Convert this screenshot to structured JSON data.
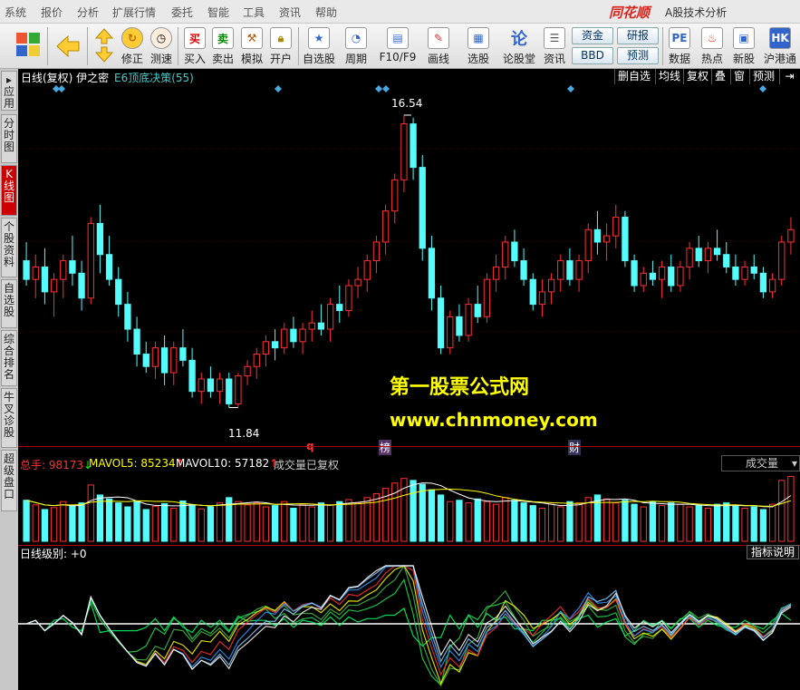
{
  "menubar": {
    "items": [
      "系统",
      "报价",
      "分析",
      "扩展行情",
      "委托",
      "智能",
      "工具",
      "资讯",
      "帮助"
    ],
    "logo": "同花顺",
    "title": "A股技术分析"
  },
  "toolbar": {
    "items": [
      "修正",
      "测速",
      "买入",
      "卖出",
      "模拟",
      "开户",
      "自选股",
      "周期",
      "F10/F9",
      "画线",
      "选股",
      "论股堂",
      "资讯",
      "数据",
      "热点",
      "新股",
      "沪港通"
    ],
    "buy_glyph": "买",
    "sell_glyph": "卖",
    "lun_glyph": "论",
    "small_buttons": [
      "资金",
      "研报",
      "BBD",
      "预测"
    ]
  },
  "sidebar": {
    "items": [
      "应用",
      "分时图",
      "K线图",
      "个股资料",
      "自选股",
      "综合排名",
      "牛叉诊股",
      "超级盘口"
    ]
  },
  "chart": {
    "header": "日线(复权)  伊之密",
    "indicator": "E6顶底决策(55)",
    "buttons": [
      "删自选",
      "均线",
      "复权",
      "叠",
      "窗",
      "预测"
    ],
    "high_label": "16.54",
    "low_label": "11.84",
    "markers": [
      "q",
      "榜",
      "财"
    ],
    "watermark1": "第一股票公式网",
    "watermark2": "www.chnmoney.com"
  },
  "volume": {
    "total_label": "总手: 98173",
    "total_arrow": "↓",
    "mavol5": "MAVOL5: 85234",
    "mavol5_arrow": "↑",
    "mavol10": "MAVOL10: 57182",
    "mavol10_arrow": "↑",
    "note": "成交量已复权",
    "dropdown": "成交量"
  },
  "indicator_panel": {
    "label": "日线级别: +0",
    "button": "指标说明"
  },
  "colors": {
    "up": "#ff3030",
    "down": "#54fcfc",
    "bg": "#000000",
    "grid": "#aa0000",
    "watermark": "#ffff00"
  },
  "chart_data": {
    "type": "candlestick",
    "price_range": [
      11.84,
      16.54
    ],
    "note": "daily OHLC candles, up=red outline, down=cyan filled",
    "series": [
      {
        "o": 14.2,
        "h": 14.5,
        "l": 13.8,
        "c": 13.9
      },
      {
        "o": 13.9,
        "h": 14.3,
        "l": 13.6,
        "c": 14.1
      },
      {
        "o": 14.1,
        "h": 14.4,
        "l": 13.5,
        "c": 13.7
      },
      {
        "o": 13.7,
        "h": 14.0,
        "l": 13.3,
        "c": 13.9
      },
      {
        "o": 13.9,
        "h": 14.3,
        "l": 13.6,
        "c": 14.2
      },
      {
        "o": 14.2,
        "h": 14.6,
        "l": 13.8,
        "c": 14.0
      },
      {
        "o": 14.0,
        "h": 14.2,
        "l": 13.4,
        "c": 13.6
      },
      {
        "o": 13.6,
        "h": 14.9,
        "l": 13.5,
        "c": 14.8
      },
      {
        "o": 14.8,
        "h": 15.1,
        "l": 14.0,
        "c": 14.3
      },
      {
        "o": 14.3,
        "h": 14.6,
        "l": 13.8,
        "c": 13.9
      },
      {
        "o": 13.9,
        "h": 14.1,
        "l": 13.3,
        "c": 13.5
      },
      {
        "o": 13.5,
        "h": 13.7,
        "l": 12.9,
        "c": 13.1
      },
      {
        "o": 13.1,
        "h": 13.3,
        "l": 12.5,
        "c": 12.7
      },
      {
        "o": 12.7,
        "h": 12.9,
        "l": 12.4,
        "c": 12.5
      },
      {
        "o": 12.5,
        "h": 12.9,
        "l": 12.3,
        "c": 12.8
      },
      {
        "o": 12.8,
        "h": 13.0,
        "l": 12.2,
        "c": 12.4
      },
      {
        "o": 12.4,
        "h": 12.9,
        "l": 12.2,
        "c": 12.8
      },
      {
        "o": 12.8,
        "h": 13.1,
        "l": 12.5,
        "c": 12.6
      },
      {
        "o": 12.6,
        "h": 12.8,
        "l": 12.0,
        "c": 12.1
      },
      {
        "o": 12.1,
        "h": 12.4,
        "l": 11.9,
        "c": 12.3
      },
      {
        "o": 12.3,
        "h": 12.5,
        "l": 12.0,
        "c": 12.1
      },
      {
        "o": 12.1,
        "h": 12.4,
        "l": 11.9,
        "c": 12.3
      },
      {
        "o": 12.3,
        "h": 12.4,
        "l": 11.84,
        "c": 11.9
      },
      {
        "o": 11.9,
        "h": 12.4,
        "l": 11.85,
        "c": 12.35
      },
      {
        "o": 12.35,
        "h": 12.6,
        "l": 12.2,
        "c": 12.5
      },
      {
        "o": 12.5,
        "h": 12.8,
        "l": 12.3,
        "c": 12.7
      },
      {
        "o": 12.7,
        "h": 13.0,
        "l": 12.5,
        "c": 12.9
      },
      {
        "o": 12.9,
        "h": 13.1,
        "l": 12.6,
        "c": 12.8
      },
      {
        "o": 12.8,
        "h": 13.2,
        "l": 12.7,
        "c": 13.1
      },
      {
        "o": 13.1,
        "h": 13.3,
        "l": 12.8,
        "c": 12.9
      },
      {
        "o": 12.9,
        "h": 13.2,
        "l": 12.7,
        "c": 13.1
      },
      {
        "o": 13.1,
        "h": 13.4,
        "l": 12.9,
        "c": 13.2
      },
      {
        "o": 13.2,
        "h": 13.5,
        "l": 13.0,
        "c": 13.1
      },
      {
        "o": 13.1,
        "h": 13.6,
        "l": 12.9,
        "c": 13.5
      },
      {
        "o": 13.5,
        "h": 13.8,
        "l": 13.2,
        "c": 13.4
      },
      {
        "o": 13.4,
        "h": 13.9,
        "l": 13.3,
        "c": 13.8
      },
      {
        "o": 13.8,
        "h": 14.1,
        "l": 13.6,
        "c": 13.9
      },
      {
        "o": 13.9,
        "h": 14.3,
        "l": 13.7,
        "c": 14.2
      },
      {
        "o": 14.2,
        "h": 14.6,
        "l": 14.0,
        "c": 14.5
      },
      {
        "o": 14.5,
        "h": 15.1,
        "l": 14.3,
        "c": 15.0
      },
      {
        "o": 15.0,
        "h": 15.6,
        "l": 14.8,
        "c": 15.5
      },
      {
        "o": 15.5,
        "h": 16.54,
        "l": 15.3,
        "c": 16.4
      },
      {
        "o": 16.4,
        "h": 16.5,
        "l": 15.5,
        "c": 15.7
      },
      {
        "o": 15.7,
        "h": 15.9,
        "l": 14.2,
        "c": 14.4
      },
      {
        "o": 14.4,
        "h": 14.6,
        "l": 13.4,
        "c": 13.6
      },
      {
        "o": 13.6,
        "h": 13.8,
        "l": 12.7,
        "c": 12.8
      },
      {
        "o": 12.8,
        "h": 13.4,
        "l": 12.7,
        "c": 13.3
      },
      {
        "o": 13.3,
        "h": 13.5,
        "l": 12.9,
        "c": 13.0
      },
      {
        "o": 13.0,
        "h": 13.6,
        "l": 12.9,
        "c": 13.5
      },
      {
        "o": 13.5,
        "h": 13.8,
        "l": 13.2,
        "c": 13.3
      },
      {
        "o": 13.3,
        "h": 14.0,
        "l": 13.2,
        "c": 13.9
      },
      {
        "o": 13.9,
        "h": 14.3,
        "l": 13.7,
        "c": 14.1
      },
      {
        "o": 14.1,
        "h": 14.6,
        "l": 13.9,
        "c": 14.5
      },
      {
        "o": 14.5,
        "h": 14.7,
        "l": 14.1,
        "c": 14.2
      },
      {
        "o": 14.2,
        "h": 14.4,
        "l": 13.8,
        "c": 13.9
      },
      {
        "o": 13.9,
        "h": 14.0,
        "l": 13.4,
        "c": 13.5
      },
      {
        "o": 13.5,
        "h": 13.9,
        "l": 13.3,
        "c": 13.7
      },
      {
        "o": 13.7,
        "h": 14.0,
        "l": 13.5,
        "c": 13.9
      },
      {
        "o": 13.9,
        "h": 14.3,
        "l": 13.7,
        "c": 14.2
      },
      {
        "o": 14.2,
        "h": 14.4,
        "l": 13.8,
        "c": 13.9
      },
      {
        "o": 13.9,
        "h": 14.3,
        "l": 13.7,
        "c": 14.2
      },
      {
        "o": 14.2,
        "h": 14.8,
        "l": 14.0,
        "c": 14.7
      },
      {
        "o": 14.7,
        "h": 15.0,
        "l": 14.3,
        "c": 14.5
      },
      {
        "o": 14.5,
        "h": 14.8,
        "l": 14.2,
        "c": 14.6
      },
      {
        "o": 14.6,
        "h": 15.1,
        "l": 14.4,
        "c": 14.9
      },
      {
        "o": 14.9,
        "h": 15.0,
        "l": 14.1,
        "c": 14.2
      },
      {
        "o": 14.2,
        "h": 14.3,
        "l": 13.7,
        "c": 13.8
      },
      {
        "o": 13.8,
        "h": 14.1,
        "l": 13.7,
        "c": 14.0
      },
      {
        "o": 14.0,
        "h": 14.2,
        "l": 13.8,
        "c": 13.9
      },
      {
        "o": 13.9,
        "h": 14.2,
        "l": 13.6,
        "c": 14.1
      },
      {
        "o": 14.1,
        "h": 14.3,
        "l": 13.7,
        "c": 13.8
      },
      {
        "o": 13.8,
        "h": 14.2,
        "l": 13.7,
        "c": 14.1
      },
      {
        "o": 14.1,
        "h": 14.5,
        "l": 13.9,
        "c": 14.4
      },
      {
        "o": 14.4,
        "h": 14.6,
        "l": 14.1,
        "c": 14.2
      },
      {
        "o": 14.2,
        "h": 14.5,
        "l": 14.0,
        "c": 14.4
      },
      {
        "o": 14.4,
        "h": 14.7,
        "l": 14.2,
        "c": 14.3
      },
      {
        "o": 14.3,
        "h": 14.5,
        "l": 14.0,
        "c": 14.1
      },
      {
        "o": 14.1,
        "h": 14.3,
        "l": 13.8,
        "c": 13.9
      },
      {
        "o": 13.9,
        "h": 14.2,
        "l": 13.8,
        "c": 14.1
      },
      {
        "o": 14.1,
        "h": 14.3,
        "l": 13.9,
        "c": 14.0
      },
      {
        "o": 14.0,
        "h": 14.1,
        "l": 13.6,
        "c": 13.7
      },
      {
        "o": 13.7,
        "h": 14.0,
        "l": 13.6,
        "c": 13.9
      },
      {
        "o": 13.9,
        "h": 14.6,
        "l": 13.8,
        "c": 14.5
      },
      {
        "o": 14.5,
        "h": 14.9,
        "l": 14.3,
        "c": 14.7
      }
    ],
    "volume": [
      62,
      55,
      48,
      51,
      60,
      54,
      58,
      85,
      70,
      64,
      58,
      52,
      60,
      48,
      53,
      57,
      50,
      61,
      55,
      49,
      52,
      58,
      66,
      60,
      55,
      58,
      52,
      54,
      60,
      50,
      56,
      52,
      58,
      55,
      60,
      63,
      58,
      66,
      72,
      80,
      88,
      95,
      92,
      86,
      78,
      70,
      60,
      62,
      58,
      64,
      60,
      56,
      66,
      62,
      58,
      54,
      50,
      56,
      52,
      60,
      58,
      66,
      70,
      64,
      58,
      62,
      56,
      52,
      60,
      54,
      58,
      56,
      52,
      54,
      50,
      56,
      58,
      54,
      50,
      52,
      48,
      56,
      92,
      98
    ]
  }
}
